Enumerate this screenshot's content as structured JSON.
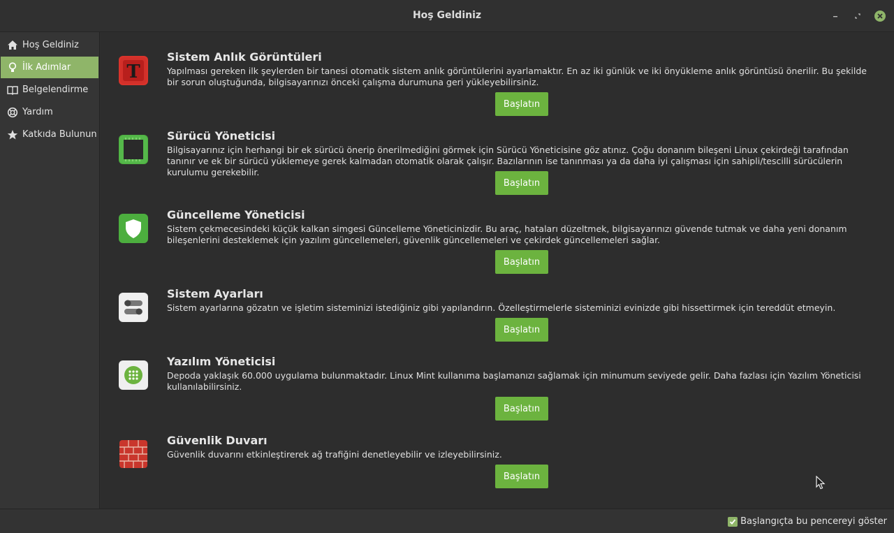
{
  "window": {
    "title": "Hoş Geldiniz",
    "controls": [
      "minimize-icon",
      "maximize-icon",
      "close-icon"
    ]
  },
  "sidebar": {
    "items": [
      {
        "label": "Hoş Geldiniz",
        "icon": "home-icon"
      },
      {
        "label": "İlk Adımlar",
        "icon": "lightbulb-icon",
        "active": true
      },
      {
        "label": "Belgelendirme",
        "icon": "book-icon"
      },
      {
        "label": "Yardım",
        "icon": "lifebuoy-icon"
      },
      {
        "label": "Katkıda Bulunun",
        "icon": "star-icon"
      }
    ]
  },
  "sections": [
    {
      "title": "Sistem Anlık Görüntüleri",
      "icon": "timeshift-icon",
      "description": "Yapılması gereken ilk şeylerden bir tanesi otomatik sistem anlık görüntülerini ayarlamaktır. En az iki günlük ve iki önyükleme anlık görüntüsü önerilir. Bu şekilde bir sorun oluştuğunda, bilgisayarınızı önceki çalışma durumuna geri yükleyebilirsiniz.",
      "button": "Başlatın"
    },
    {
      "title": "Sürücü Yöneticisi",
      "icon": "chip-icon",
      "description": "Bilgisayarınız için herhangi bir ek sürücü önerip önerilmediğini görmek için Sürücü Yöneticisine göz atınız. Çoğu donanım bileşeni Linux çekirdeği tarafından tanınır ve ek bir sürücü yüklemeye gerek kalmadan otomatik olarak çalışır. Bazılarının ise tanınması ya da daha iyi çalışması için sahipli/tescilli sürücülerin kurulumu gerekebilir.",
      "button": "Başlatın"
    },
    {
      "title": "Güncelleme Yöneticisi",
      "icon": "shield-icon",
      "description": "Sistem çekmecesindeki küçük kalkan simgesi Güncelleme Yöneticinizdir. Bu araç, hataları düzeltmek, bilgisayarınızı güvende tutmak ve daha yeni donanım bileşenlerini desteklemek için yazılım güncellemeleri, güvenlik güncellemeleri ve çekirdek güncellemeleri sağlar.",
      "button": "Başlatın"
    },
    {
      "title": "Sistem Ayarları",
      "icon": "toggles-icon",
      "description": "Sistem ayarlarına gözatın ve işletim sisteminizi istediğiniz gibi yapılandırın. Özelleştirmelerle sisteminizi evinizde gibi hissettirmek için tereddüt etmeyin.",
      "button": "Başlatın"
    },
    {
      "title": "Yazılım Yöneticisi",
      "icon": "app-grid-icon",
      "description": "Depoda yaklaşık 60.000 uygulama bulunmaktadır. Linux Mint kullanıma başlamanızı sağlamak için minumum seviyede gelir. Daha fazlası için Yazılım Yöneticisi kullanılabilirsiniz.",
      "button": "Başlatın"
    },
    {
      "title": "Güvenlik Duvarı",
      "icon": "brick-wall-icon",
      "description": "Güvenlik duvarını etkinleştirerek ağ trafiğini denetleyebilir ve izleyebilirsiniz.",
      "button": "Başlatın"
    }
  ],
  "footer": {
    "checkbox_label": "Başlangıçta bu pencereyi göster",
    "checked": true
  },
  "colors": {
    "accent": "#8fb569",
    "button": "#6cb33f",
    "background": "#2d2d2d"
  }
}
